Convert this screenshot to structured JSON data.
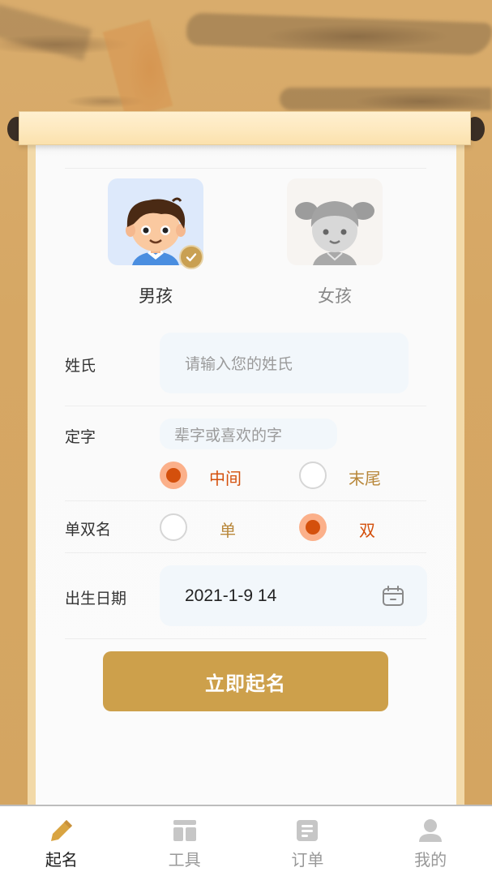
{
  "colors": {
    "accent": "#cda04b",
    "radio_selected": "#d4500c",
    "radio_unselected_text": "#b8873a",
    "input_bg": "#f2f7fb",
    "tab_active_icon": "#d9a441",
    "tab_inactive": "#c6c6c6"
  },
  "gender": {
    "options": [
      {
        "label": "男孩",
        "icon": "boy-avatar",
        "selected": true
      },
      {
        "label": "女孩",
        "icon": "girl-avatar",
        "selected": false
      }
    ]
  },
  "form": {
    "surname": {
      "label": "姓氏",
      "placeholder": "请输入您的姓氏",
      "value": ""
    },
    "fixed_char": {
      "label": "定字",
      "placeholder": "辈字或喜欢的字",
      "value": "",
      "position_options": [
        {
          "label": "中间",
          "selected": true
        },
        {
          "label": "末尾",
          "selected": false
        }
      ]
    },
    "name_length": {
      "label": "单双名",
      "options": [
        {
          "label": "单",
          "selected": false
        },
        {
          "label": "双",
          "selected": true
        }
      ]
    },
    "birth": {
      "label": "出生日期",
      "value": "2021-1-9 14",
      "icon": "calendar-icon"
    },
    "submit_label": "立即起名"
  },
  "tabbar": {
    "items": [
      {
        "label": "起名",
        "icon": "pencil-icon",
        "active": true
      },
      {
        "label": "工具",
        "icon": "tools-icon",
        "active": false
      },
      {
        "label": "订单",
        "icon": "order-icon",
        "active": false
      },
      {
        "label": "我的",
        "icon": "user-icon",
        "active": false
      }
    ]
  }
}
